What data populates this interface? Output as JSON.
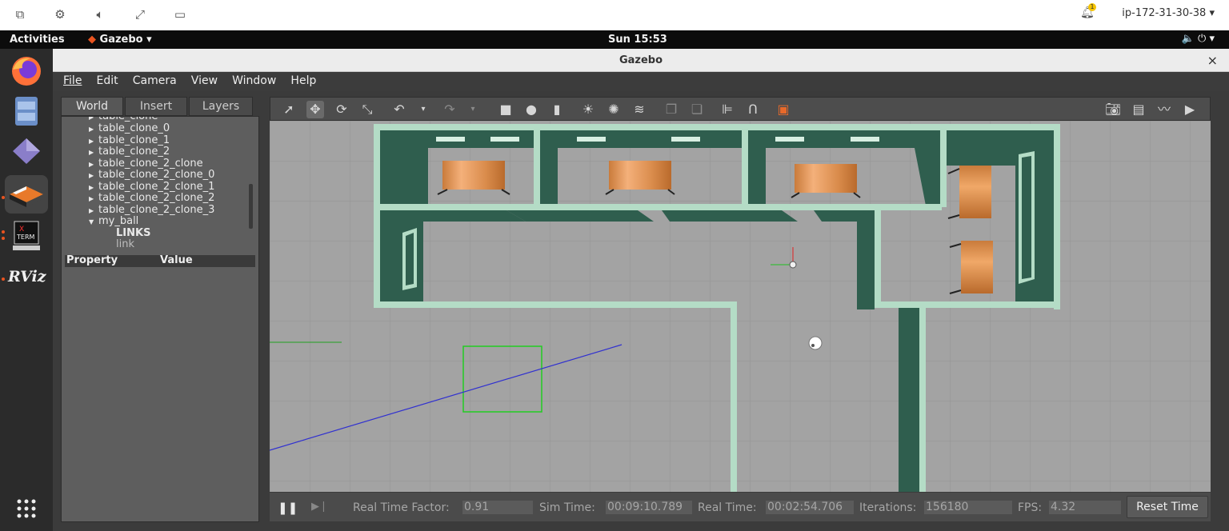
{
  "viewer": {
    "host": "ip-172-31-30-38 ▾",
    "notifications": "1",
    "icons": [
      "windows-icon",
      "gear-icon",
      "speaker-icon",
      "fullscreen-icon",
      "display-icon"
    ]
  },
  "topbar": {
    "activities": "Activities",
    "app": "Gazebo ▾",
    "clock": "Sun 15:53",
    "tray": "🔈 ⏻ ▾"
  },
  "dock": {
    "apps": [
      "firefox-icon",
      "files-icon",
      "app-icon",
      "gazebo-icon",
      "xterm-icon",
      "rviz-icon"
    ],
    "rviz_label": "RViz",
    "xterm_label": "X TERM"
  },
  "window": {
    "title": "Gazebo",
    "close": "×"
  },
  "menu": [
    "File",
    "Edit",
    "Camera",
    "View",
    "Window",
    "Help"
  ],
  "left_panel": {
    "tabs": [
      "World",
      "Insert",
      "Layers"
    ],
    "tree": [
      {
        "label": "table_clone",
        "indent": 1
      },
      {
        "label": "table_clone_0",
        "indent": 1
      },
      {
        "label": "table_clone_1",
        "indent": 1
      },
      {
        "label": "table_clone_2",
        "indent": 1
      },
      {
        "label": "table_clone_2_clone",
        "indent": 1
      },
      {
        "label": "table_clone_2_clone_0",
        "indent": 1
      },
      {
        "label": "table_clone_2_clone_1",
        "indent": 1
      },
      {
        "label": "table_clone_2_clone_2",
        "indent": 1
      },
      {
        "label": "table_clone_2_clone_3",
        "indent": 1
      },
      {
        "label": "my_ball",
        "indent": 1
      }
    ],
    "links_label": "LINKS",
    "link_item": "link",
    "property_header": "Property",
    "value_header": "Value"
  },
  "toolbar": {
    "tools": [
      "select-icon",
      "translate-icon",
      "rotate-icon",
      "scale-icon",
      "undo-icon",
      "redo-icon",
      "box-icon",
      "sphere-icon",
      "cylinder-icon",
      "point-light-icon",
      "spot-light-icon",
      "directional-light-icon",
      "copy-icon",
      "paste-icon",
      "align-icon",
      "snap-icon",
      "color-icon"
    ],
    "right_tools": [
      "screenshot-icon",
      "log-icon",
      "plot-icon",
      "video-icon"
    ]
  },
  "bottom": {
    "rtf_label": "Real Time Factor:",
    "rtf_value": "0.91",
    "sim_label": "Sim Time:",
    "sim_value": "00:09:10.789",
    "real_label": "Real Time:",
    "real_value": "00:02:54.706",
    "iter_label": "Iterations:",
    "iter_value": "156180",
    "fps_label": "FPS:",
    "fps_value": "4.32",
    "reset_label": "Reset Time"
  }
}
